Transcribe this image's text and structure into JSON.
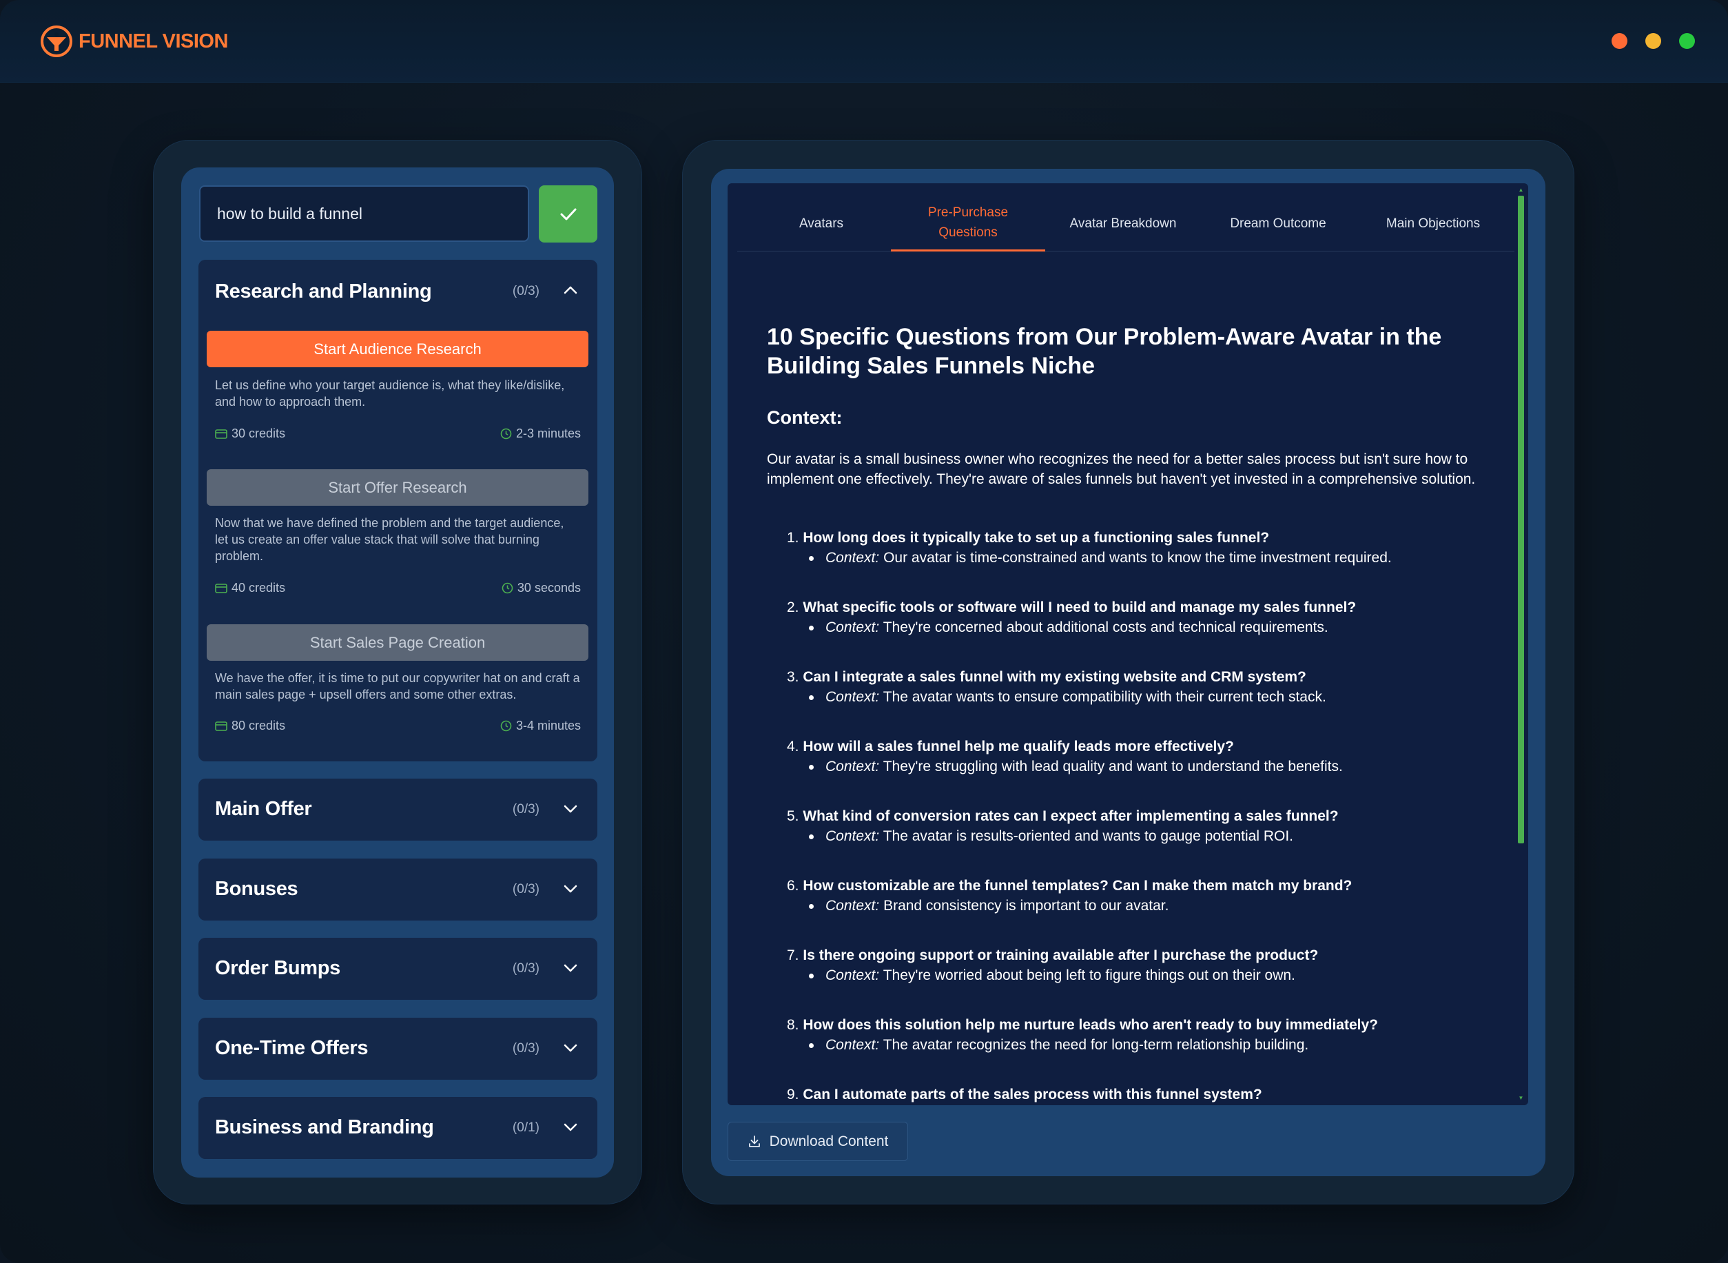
{
  "app": {
    "brand_name": "FUNNEL VISION",
    "brand_color": "#ff7a35",
    "window_dots": [
      "#ff6b35",
      "#f5b531",
      "#27c93f"
    ]
  },
  "search": {
    "value": "how to build a funnel",
    "confirm_icon": "check-icon"
  },
  "sections": [
    {
      "title": "Research and Planning",
      "count": "(0/3)",
      "expanded": true,
      "actions": [
        {
          "label": "Start Audience Research",
          "description": "Let us define who your target audience is, what they like/dislike, and how to approach them.",
          "credits": "30 credits",
          "time": "2-3 minutes",
          "enabled": true
        },
        {
          "label": "Start Offer Research",
          "description": "Now that we have defined the problem and the target audience, let us create an offer value stack that will solve that burning problem.",
          "credits": "40 credits",
          "time": "30 seconds",
          "enabled": false
        },
        {
          "label": "Start Sales Page Creation",
          "description": "We have the offer, it is time to put our copywriter hat on and craft a main sales page + upsell offers and some other extras.",
          "credits": "80 credits",
          "time": "3-4 minutes",
          "enabled": false
        }
      ]
    },
    {
      "title": "Main Offer",
      "count": "(0/3)",
      "expanded": false
    },
    {
      "title": "Bonuses",
      "count": "(0/3)",
      "expanded": false
    },
    {
      "title": "Order Bumps",
      "count": "(0/3)",
      "expanded": false
    },
    {
      "title": "One-Time Offers",
      "count": "(0/3)",
      "expanded": false
    },
    {
      "title": "Business and Branding",
      "count": "(0/1)",
      "expanded": false
    }
  ],
  "tabs": [
    {
      "label": "Avatars",
      "active": false
    },
    {
      "label": "Pre-Purchase Questions",
      "active": true
    },
    {
      "label": "Avatar Breakdown",
      "active": false
    },
    {
      "label": "Dream Outcome",
      "active": false
    },
    {
      "label": "Main Objections",
      "active": false
    }
  ],
  "document": {
    "title": "10 Specific Questions from Our Problem-Aware Avatar in the Building Sales Funnels Niche",
    "context_heading": "Context:",
    "context_text": "Our avatar is a small business owner who recognizes the need for a better sales process but isn't sure how to implement one effectively. They're aware of sales funnels but haven't yet invested in a comprehensive solution.",
    "context_label": "Context:",
    "questions": [
      {
        "num": "1.",
        "q": "How long does it typically take to set up a functioning sales funnel?",
        "ctx": "Our avatar is time-constrained and wants to know the time investment required."
      },
      {
        "num": "2.",
        "q": "What specific tools or software will I need to build and manage my sales funnel?",
        "ctx": "They're concerned about additional costs and technical requirements."
      },
      {
        "num": "3.",
        "q": "Can I integrate a sales funnel with my existing website and CRM system?",
        "ctx": "The avatar wants to ensure compatibility with their current tech stack."
      },
      {
        "num": "4.",
        "q": "How will a sales funnel help me qualify leads more effectively?",
        "ctx": "They're struggling with lead quality and want to understand the benefits."
      },
      {
        "num": "5.",
        "q": "What kind of conversion rates can I expect after implementing a sales funnel?",
        "ctx": "The avatar is results-oriented and wants to gauge potential ROI."
      },
      {
        "num": "6.",
        "q": "How customizable are the funnel templates? Can I make them match my brand?",
        "ctx": "Brand consistency is important to our avatar."
      },
      {
        "num": "7.",
        "q": "Is there ongoing support or training available after I purchase the product?",
        "ctx": "They're worried about being left to figure things out on their own."
      },
      {
        "num": "8.",
        "q": "How does this solution help me nurture leads who aren't ready to buy immediately?",
        "ctx": "The avatar recognizes the need for long-term relationship building."
      },
      {
        "num": "9.",
        "q": "Can I automate parts of the sales process with this funnel system?",
        "ctx": ""
      }
    ]
  },
  "download": {
    "label": "Download Content",
    "icon": "download-icon"
  }
}
